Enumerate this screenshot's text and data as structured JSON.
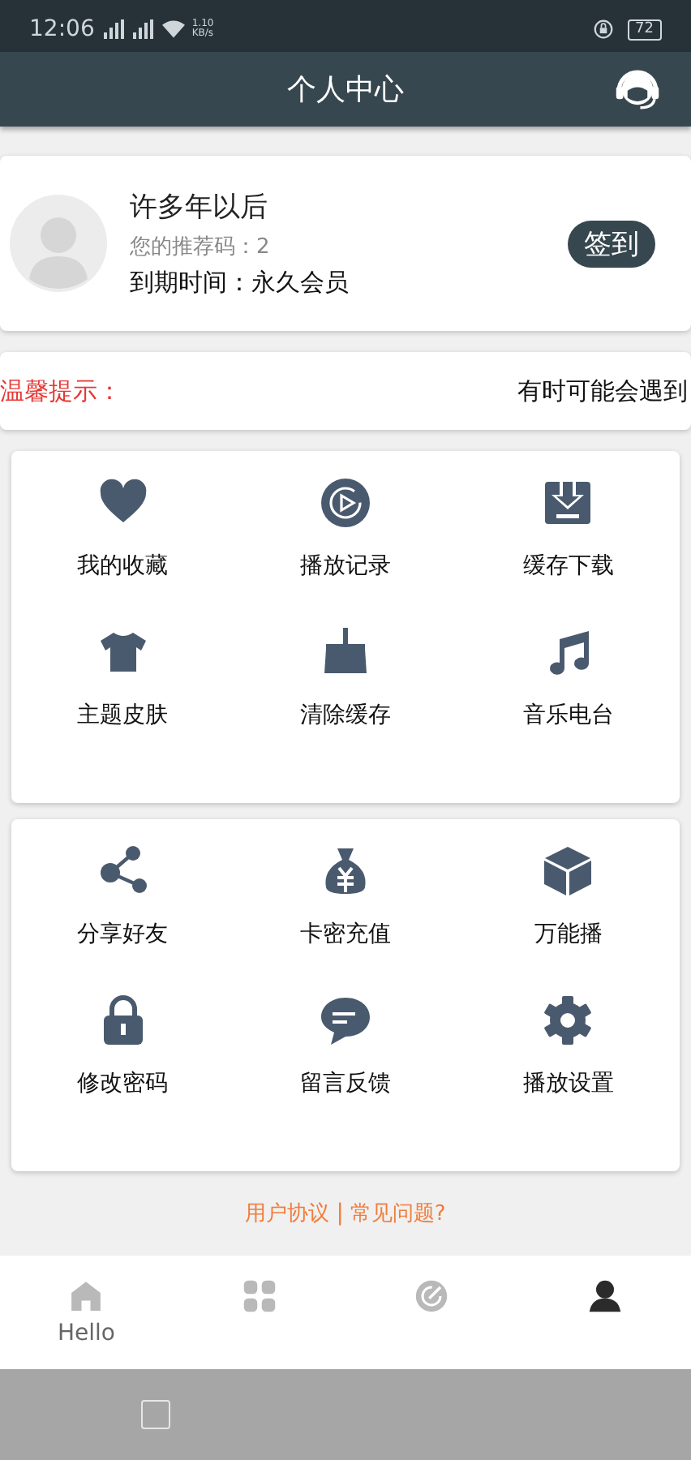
{
  "status_bar": {
    "time": "12:06",
    "network_speed": "1.10",
    "network_unit": "KB/s",
    "battery": "72"
  },
  "header": {
    "title": "个人中心"
  },
  "profile": {
    "name": "许多年以后",
    "referral": "您的推荐码：2",
    "expiry": "到期时间：永久会员",
    "sign_in_button": "签到"
  },
  "notice": {
    "label": "温馨提示：",
    "text": "有时可能会遇到"
  },
  "grids": [
    {
      "items": [
        {
          "kind": "heart",
          "label": "我的收藏"
        },
        {
          "kind": "play",
          "label": "播放记录"
        },
        {
          "kind": "download",
          "label": "缓存下载"
        },
        {
          "kind": "shirt",
          "label": "主题皮肤"
        },
        {
          "kind": "broom",
          "label": "清除缓存"
        },
        {
          "kind": "music",
          "label": "音乐电台"
        }
      ]
    },
    {
      "items": [
        {
          "kind": "share",
          "label": "分享好友"
        },
        {
          "kind": "moneybag",
          "label": "卡密充值"
        },
        {
          "kind": "cube",
          "label": "万能播"
        },
        {
          "kind": "lock",
          "label": "修改密码"
        },
        {
          "kind": "chat",
          "label": "留言反馈"
        },
        {
          "kind": "gear",
          "label": "播放设置"
        }
      ]
    }
  ],
  "footer_links": {
    "agreement": "用户协议",
    "separator": "|",
    "faq": "常见问题?"
  },
  "tabs": [
    {
      "kind": "home",
      "label": "Hello",
      "selected": false
    },
    {
      "kind": "apps",
      "selected": false
    },
    {
      "kind": "compass",
      "selected": false
    },
    {
      "kind": "person",
      "selected": true
    }
  ]
}
